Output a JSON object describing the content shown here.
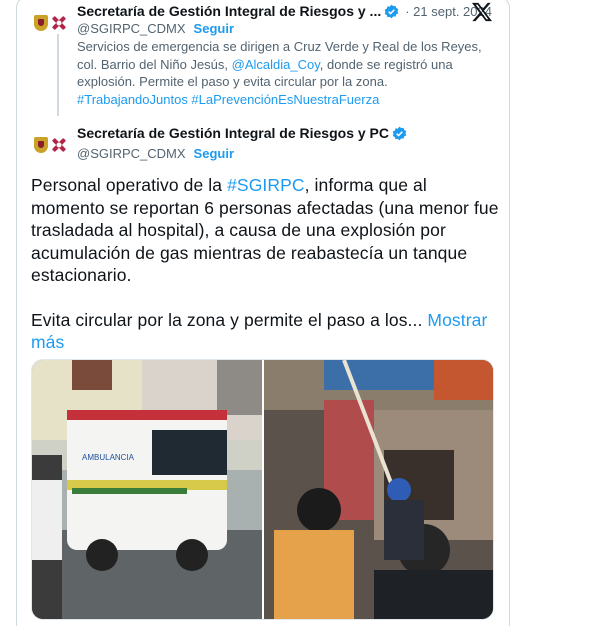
{
  "quoted_post": {
    "author_name": "Secretaría de Gestión Integral de Riesgos y ...",
    "handle": "@SGIRPC_CDMX",
    "follow_label": "Seguir",
    "date": "· 21 sept. 2024",
    "text_part1": "Servicios de emergencia se dirigen a Cruz Verde y Real de los Reyes, col. Barrio del Niño Jesús, ",
    "mention": "@Alcaldia_Coy",
    "text_part2": ", donde se registró una explosión. Permite el paso y evita circular por la zona.",
    "hashtags": "#TrabajandoJuntos #LaPrevenciónEsNuestraFuerza"
  },
  "main_post": {
    "author_name": "Secretaría de Gestión Integral de Riesgos y PC",
    "handle": "@SGIRPC_CDMX",
    "follow_label": "Seguir",
    "text_part1": "Personal operativo de la ",
    "hashtag": "#SGIRPC",
    "text_part2": ", informa que al momento se reportan 6 personas afectadas (una menor fue trasladada al hospital), a causa de una explosión por acumulación de gas mientras de reabastecía un tanque estacionario.",
    "text_part3": "Evita circular por la zona y permite el paso a los... ",
    "show_more_label": "Mostrar más",
    "ambulance_label": "AMBULANCIA"
  },
  "icons": {
    "verified": "verified-badge-icon",
    "x_logo": "x-logo-icon"
  },
  "colors": {
    "link": "#1d9bf0",
    "secondary_text": "#536471",
    "border": "#cfd9de"
  }
}
